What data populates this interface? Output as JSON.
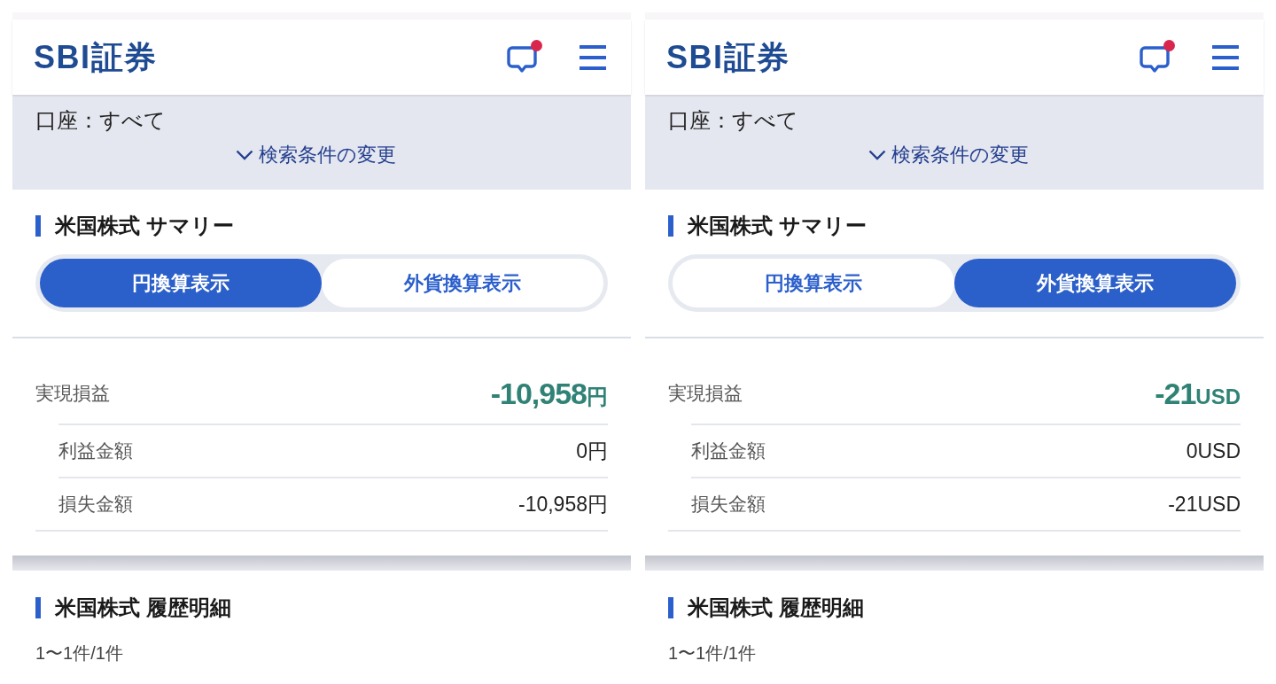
{
  "screens": [
    {
      "header": {
        "logo": "SBI証券",
        "unread": true
      },
      "filter": {
        "account": "口座：すべて",
        "toggle": "検索条件の変更"
      },
      "summary": {
        "title": "米国株式 サマリー",
        "tabs": [
          {
            "label": "円換算表示",
            "selected": true
          },
          {
            "label": "外貨換算表示",
            "selected": false
          }
        ],
        "total": {
          "label": "実現損益",
          "amount": "-10,958",
          "unit": "円"
        },
        "rows": [
          {
            "label": "利益金額",
            "value": "0円"
          },
          {
            "label": "損失金額",
            "value": "-10,958円"
          }
        ]
      },
      "history": {
        "title": "米国株式 履歴明細",
        "count": "1〜1件/1件"
      }
    },
    {
      "header": {
        "logo": "SBI証券",
        "unread": true
      },
      "filter": {
        "account": "口座：すべて",
        "toggle": "検索条件の変更"
      },
      "summary": {
        "title": "米国株式 サマリー",
        "tabs": [
          {
            "label": "円換算表示",
            "selected": false
          },
          {
            "label": "外貨換算表示",
            "selected": true
          }
        ],
        "total": {
          "label": "実現損益",
          "amount": "-21",
          "unit": "USD"
        },
        "rows": [
          {
            "label": "利益金額",
            "value": "0USD"
          },
          {
            "label": "損失金額",
            "value": "-21USD"
          }
        ]
      },
      "history": {
        "title": "米国株式 履歴明細",
        "count": "1〜1件/1件"
      }
    }
  ]
}
